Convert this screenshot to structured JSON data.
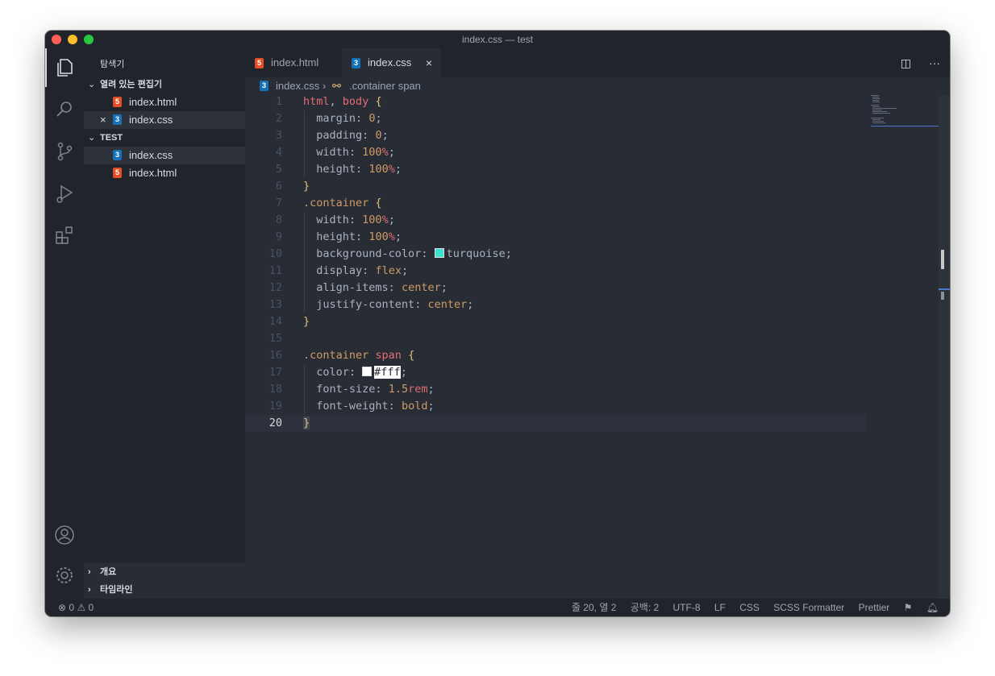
{
  "window": {
    "title": "index.css — test"
  },
  "sidebar": {
    "title": "탐색기",
    "open_editors": {
      "header": "열려 있는 편집기",
      "files": [
        {
          "name": "index.html",
          "type": "html"
        },
        {
          "name": "index.css",
          "type": "css",
          "active": true
        }
      ]
    },
    "workspace": {
      "header": "TEST",
      "files": [
        {
          "name": "index.css",
          "type": "css",
          "selected": true
        },
        {
          "name": "index.html",
          "type": "html"
        }
      ]
    },
    "outline": "개요",
    "timeline": "타임라인"
  },
  "tabs": [
    {
      "label": "index.html",
      "type": "html",
      "active": false
    },
    {
      "label": "index.css",
      "type": "css",
      "active": true
    }
  ],
  "breadcrumb": {
    "file": "index.css",
    "symbol": ".container span"
  },
  "editor": {
    "current_line": 20,
    "lines": [
      "1",
      "2",
      "3",
      "4",
      "5",
      "6",
      "7",
      "8",
      "9",
      "10",
      "11",
      "12",
      "13",
      "14",
      "15",
      "16",
      "17",
      "18",
      "19",
      "20"
    ]
  },
  "status": {
    "errors": "0",
    "warnings": "0",
    "position": "줄 20, 열 2",
    "spaces": "공백: 2",
    "encoding": "UTF-8",
    "eol": "LF",
    "language": "CSS",
    "formatter": "SCSS Formatter",
    "prettier": "Prettier"
  },
  "colors": {
    "accent_html": "#e44d26",
    "accent_css": "#1572b6",
    "turquoise": "#40e0d0"
  }
}
